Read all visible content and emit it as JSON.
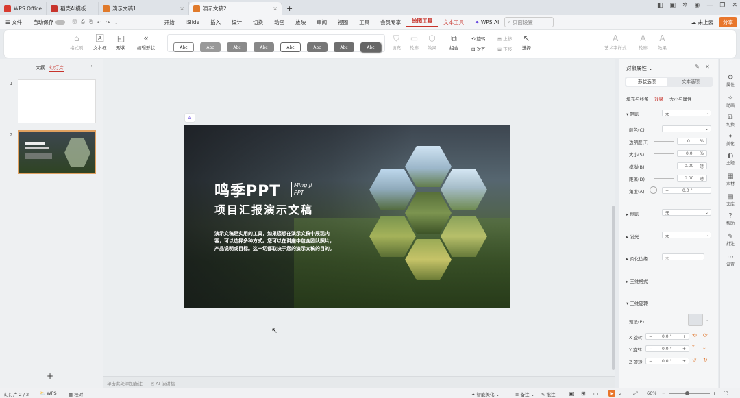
{
  "tabs": [
    {
      "label": "WPS Office",
      "color": "#d83b30"
    },
    {
      "label": "稻壳AI模板",
      "color": "#c7342c"
    },
    {
      "label": "演示文稿1",
      "color": "#e07a2b"
    },
    {
      "label": "演示文稿2",
      "color": "#e07a2b"
    }
  ],
  "tab_new": "+",
  "menu": {
    "file": "文件",
    "autosave": "自动保存",
    "items": [
      "开始",
      "iSlide",
      "插入",
      "设计",
      "切换",
      "动画",
      "放映",
      "审阅",
      "视图",
      "工具",
      "会员专享",
      "绘图工具",
      "文本工具",
      "WPS AI"
    ],
    "search": "页面设置",
    "cloud": "未上云",
    "share": "分享"
  },
  "ribbon": {
    "format_painter": "格式刷",
    "textbox": "文本框",
    "shape": "形状",
    "edit_shape": "编辑形状",
    "styles": [
      "Abc",
      "Abc",
      "Abc",
      "Abc",
      "Abc",
      "Abc",
      "Abc",
      "Abc"
    ],
    "fill": "填充",
    "outline": "轮廓",
    "effect": "效果",
    "combine": "组合",
    "rotate": "旋转",
    "align": "对齐",
    "up": "上移",
    "down": "下移",
    "select": "选择",
    "art_preset": "艺术字样式",
    "text_outline": "轮廓",
    "text_effect": "效果"
  },
  "leftpane": {
    "outline_tab": "大纲",
    "slides_tab": "幻灯片",
    "nums": [
      "1",
      "2"
    ],
    "add": "+"
  },
  "slide": {
    "title_main": "鸣季PPT",
    "brand_line1": "Ming Ji",
    "brand_line2": "PPT",
    "subtitle": "项目汇报演示文稿",
    "body": "演示文稿是实用的工具，如果您想在演示文稿中展现内容，可以选择多种方式。您可以在讲座中包含团队照片，产品说明或目标。这一切都取决于您的演示文稿的目的。",
    "ai_badge": "A"
  },
  "notes": {
    "placeholder": "单击此处添加备注",
    "ai_notes": "AI 演讲稿"
  },
  "props": {
    "title": "对象属性",
    "tab_shape": "形状选项",
    "tab_text": "文本选项",
    "sub_fill": "填充与线条",
    "sub_effect": "效果",
    "sub_size": "大小与属性",
    "shadow": "阴影",
    "shadow_val": "无",
    "color": "颜色(C)",
    "transparency": "透明度(T)",
    "t_val": "0",
    "t_unit": "%",
    "size": "大小(S)",
    "s_val": "0.0",
    "s_unit": "%",
    "blur": "模糊(B)",
    "b_val": "0.00",
    "b_unit": "磅",
    "distance": "距离(D)",
    "d_val": "0.00",
    "d_unit": "磅",
    "angle": "角度(A)",
    "a_val": "0.0",
    "a_unit": "°",
    "reflection": "倒影",
    "reflection_val": "无",
    "glow": "发光",
    "glow_val": "无",
    "soft_edge": "柔化边缘",
    "soft_val": "无",
    "format3d": "三维格式",
    "rotation3d": "三维旋转",
    "preset": "预设(P)",
    "xrot": "X 旋转",
    "yrot": "Y 旋转",
    "zrot": "Z 旋转",
    "rot_val": "0.0",
    "rot_unit": "°",
    "minus": "−",
    "plus": "+"
  },
  "sidebar": [
    "属性",
    "动画",
    "切换",
    "美化",
    "主题",
    "素材",
    "文库",
    "帮助",
    "批注",
    "设置"
  ],
  "status": {
    "slide_info": "幻灯片 2 / 2",
    "wps": "WPS",
    "proof": "校对",
    "smart": "智能美化",
    "notes": "备注",
    "comments": "批注",
    "zoom": "66%"
  }
}
